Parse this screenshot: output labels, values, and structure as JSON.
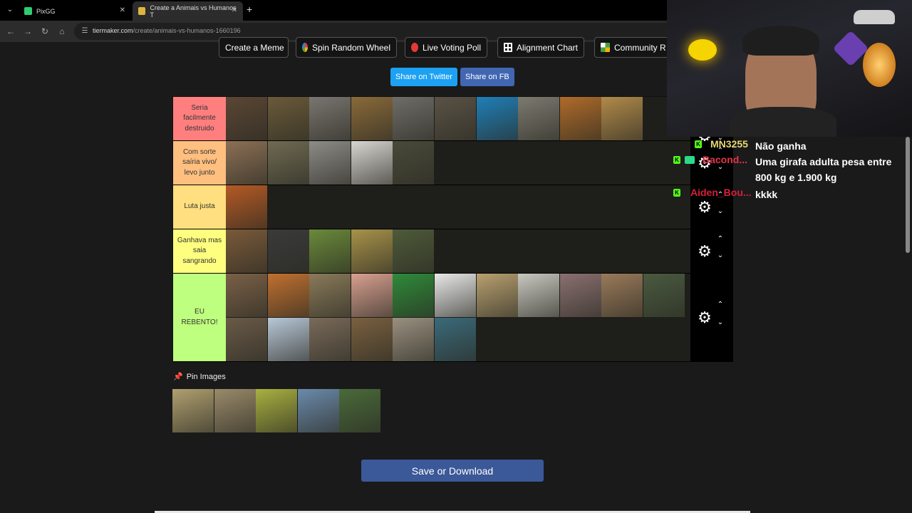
{
  "browser": {
    "tabs": [
      {
        "title": "PixGG",
        "favicon_color": "#2ecc71"
      },
      {
        "title": "Create a Animais vs Humanos T",
        "favicon_color": "#e0b340"
      }
    ],
    "url_domain": "tiermaker.com",
    "url_path": "/create/animais-vs-humanos-1660196"
  },
  "page": {
    "top_buttons": [
      {
        "label": "Create a Meme",
        "icon": "none"
      },
      {
        "label": "Spin Random Wheel",
        "icon": "wheel-icon",
        "color": "#f4b400"
      },
      {
        "label": "Live Voting Poll",
        "icon": "poll-dot-icon",
        "color": "#e53935"
      },
      {
        "label": "Alignment Chart",
        "icon": "grid-icon"
      },
      {
        "label": "Community R",
        "icon": "community-grid-icon"
      }
    ],
    "share_twitter": "Share on Twitter",
    "share_fb": "Share on FB",
    "pin_label": "Pin Images",
    "save_label": "Save or Download"
  },
  "tiers": [
    {
      "label": "Seria facilmente destruido",
      "color": "#ff7f7f",
      "items": [
        {
          "name": "bear",
          "color": "#5b4634"
        },
        {
          "name": "moose",
          "color": "#6b5a3a"
        },
        {
          "name": "hippo",
          "color": "#7a7570"
        },
        {
          "name": "jaguar",
          "color": "#8a6a3a"
        },
        {
          "name": "elephant",
          "color": "#6f6d68"
        },
        {
          "name": "komodo",
          "color": "#5a5246"
        },
        {
          "name": "shark",
          "color": "#1f7fb8"
        },
        {
          "name": "rhino",
          "color": "#7d7a70"
        },
        {
          "name": "tiger",
          "color": "#b06b2a"
        },
        {
          "name": "lion",
          "color": "#b18a4a"
        }
      ]
    },
    {
      "label": "Com sorte saíria vivo/ levo junto",
      "color": "#ffbf7f",
      "items": [
        {
          "name": "hyena",
          "color": "#8c7055"
        },
        {
          "name": "crocodile",
          "color": "#6f6a52"
        },
        {
          "name": "wolf",
          "color": "#8e8c88"
        },
        {
          "name": "chimpanzee",
          "color": "#d8d6d2"
        },
        {
          "name": "boar",
          "color": "#4a4a3a"
        }
      ]
    },
    {
      "label": "Luta justa",
      "color": "#ffdf7f",
      "items": [
        {
          "name": "orangutan",
          "color": "#b45a25"
        }
      ]
    },
    {
      "label": "Ganhava mas saia sangrando",
      "color": "#ffff7f",
      "items": [
        {
          "name": "dog",
          "color": "#7a5a3a"
        },
        {
          "name": "eagle",
          "color": "#3a3a3a"
        },
        {
          "name": "maned-wolf",
          "color": "#6a8a3a"
        },
        {
          "name": "cheetah",
          "color": "#a8924a"
        },
        {
          "name": "tapir",
          "color": "#4e5a3a"
        }
      ]
    },
    {
      "label": "EU REBENTO!",
      "color": "#bfff7f",
      "items": [
        {
          "name": "capybara",
          "color": "#7a6048"
        },
        {
          "name": "tamarin",
          "color": "#c07030"
        },
        {
          "name": "ocelot",
          "color": "#8a7a5a"
        },
        {
          "name": "pig",
          "color": "#d8a090"
        },
        {
          "name": "macaw",
          "color": "#2f8a3a"
        },
        {
          "name": "penguin",
          "color": "#e8e8e8"
        },
        {
          "name": "ostrich",
          "color": "#b8a070"
        },
        {
          "name": "goose",
          "color": "#c8c8c0"
        },
        {
          "name": "river-dolphin",
          "color": "#8a7070"
        },
        {
          "name": "deer",
          "color": "#9a7a5a"
        },
        {
          "name": "harpy-eagle",
          "color": "#4a5a40"
        },
        {
          "name": "cat",
          "color": "#6a5a48"
        },
        {
          "name": "swan",
          "color": "#b8c8d8"
        },
        {
          "name": "piranha",
          "color": "#7a6a5a"
        },
        {
          "name": "owl",
          "color": "#7a6040"
        },
        {
          "name": "zebra",
          "color": "#9a9080"
        },
        {
          "name": "peacock",
          "color": "#3a6a7a"
        }
      ]
    }
  ],
  "pinned": [
    {
      "name": "giraffe",
      "color": "#b0a070"
    },
    {
      "name": "cobra",
      "color": "#9a8a6a"
    },
    {
      "name": "kangaroo",
      "color": "#a8b040"
    },
    {
      "name": "horse",
      "color": "#6a8aaa"
    },
    {
      "name": "panda",
      "color": "#4a6a3a"
    }
  ],
  "chat": [
    {
      "user": "MN3255",
      "user_color": "#e8d870",
      "text": "Não ganha"
    },
    {
      "user": "Bacond...",
      "user_color": "#e5344a",
      "text": "Uma girafa adulta pesa entre 800 kg e 1.900 kg"
    },
    {
      "user": "Aiden_Bou...",
      "user_color": "#d81f3a",
      "text": "kkkk"
    }
  ]
}
